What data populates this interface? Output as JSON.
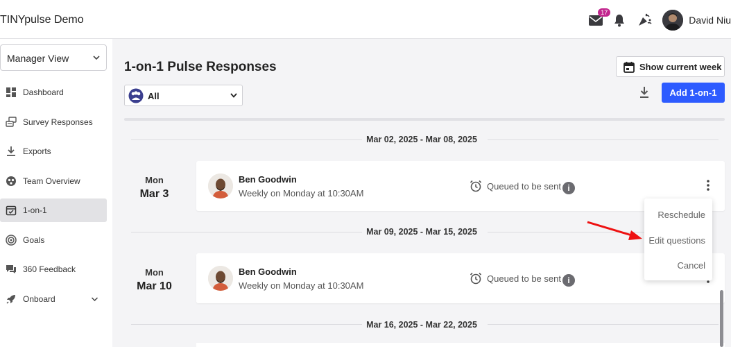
{
  "header": {
    "app_title": "TINYpulse Demo",
    "mail_count": "17",
    "user_name": "David Niu"
  },
  "sidebar": {
    "view_select": "Manager View",
    "items": [
      {
        "label": "Dashboard",
        "icon": "dashboard-icon"
      },
      {
        "label": "Survey Responses",
        "icon": "survey-responses-icon"
      },
      {
        "label": "Exports",
        "icon": "download-icon"
      },
      {
        "label": "Team Overview",
        "icon": "team-overview-icon"
      },
      {
        "label": "1-on-1",
        "icon": "calendar-check-icon",
        "active": true
      },
      {
        "label": "Goals",
        "icon": "target-icon"
      },
      {
        "label": "360 Feedback",
        "icon": "chat-bubbles-icon"
      },
      {
        "label": "Onboard",
        "icon": "rocket-icon",
        "expandable": true
      }
    ]
  },
  "main": {
    "title": "1-on-1 Pulse Responses",
    "show_week_label": "Show current week",
    "filter_value": "All",
    "add_label": "Add 1-on-1",
    "weeks": [
      {
        "range": "Mar 02, 2025 - Mar 08, 2025",
        "day_name": "Mon",
        "day_date": "Mar 3",
        "name": "Ben Goodwin",
        "schedule": "Weekly on Monday at 10:30AM",
        "status": "Queued to be sent"
      },
      {
        "range": "Mar 09, 2025 - Mar 15, 2025",
        "day_name": "Mon",
        "day_date": "Mar 10",
        "name": "Ben Goodwin",
        "schedule": "Weekly on Monday at 10:30AM",
        "status": "Queued to be sent"
      },
      {
        "range": "Mar 16, 2025 - Mar 22, 2025"
      }
    ],
    "menu": {
      "reschedule": "Reschedule",
      "edit_questions": "Edit questions",
      "cancel": "Cancel"
    },
    "colors": {
      "accent": "#2d5bff",
      "badge": "#c2268e",
      "annotation_arrow": "#ee1111"
    }
  }
}
